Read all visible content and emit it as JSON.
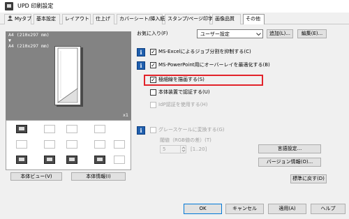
{
  "window": {
    "title": "UPD 印刷設定"
  },
  "tabs": [
    {
      "label": "Myタブ",
      "active": false
    },
    {
      "label": "基本設定",
      "active": false
    },
    {
      "label": "レイアウト",
      "active": false
    },
    {
      "label": "仕上げ",
      "active": false
    },
    {
      "label": "カバーシート/挿入紙",
      "active": false
    },
    {
      "label": "スタンプ/ページ印字",
      "active": false
    },
    {
      "label": "画像品質",
      "active": false
    },
    {
      "label": "その他",
      "active": true
    }
  ],
  "preview": {
    "line1": "A4 (210x297 mm)",
    "arrow": "▼",
    "line2": "A4 (210x297 mm)",
    "copies": "x1"
  },
  "left_buttons": {
    "printer_view": "本体ビュー(V)",
    "printer_info": "本体情報(I)"
  },
  "favorites": {
    "label": "お気に入り(F)",
    "value": "ユーザー設定",
    "add": "追加(L)...",
    "edit": "編集(E)..."
  },
  "options": {
    "excel_split": "MS-Excelによるジョブ分割を抑制する(C)",
    "ppt_overlay": "MS-PowerPoint用にオーバーレイを最適化する(B)",
    "thin_lines": "極細線を描画する(S)",
    "device_auth": "本体装置で認証する(U)",
    "idp_auth": "IdP認証を使用する(H)",
    "grayscale": "グレースケールに変換する(G)"
  },
  "threshold": {
    "label": "閾値（RGB値の差）(T)",
    "value": "5",
    "range": "[1..20]"
  },
  "buttons": {
    "language": "言語設定...",
    "version": "バージョン情報(O)...",
    "defaults": "標準に戻す(D)",
    "ok": "OK",
    "cancel": "キャンセル",
    "apply": "適用(A)",
    "help": "ヘルプ"
  },
  "colors": {
    "accent": "#0078d7",
    "info_icon": "#1f5fae",
    "highlight": "#e2232a",
    "preview_bg": "#838383"
  }
}
